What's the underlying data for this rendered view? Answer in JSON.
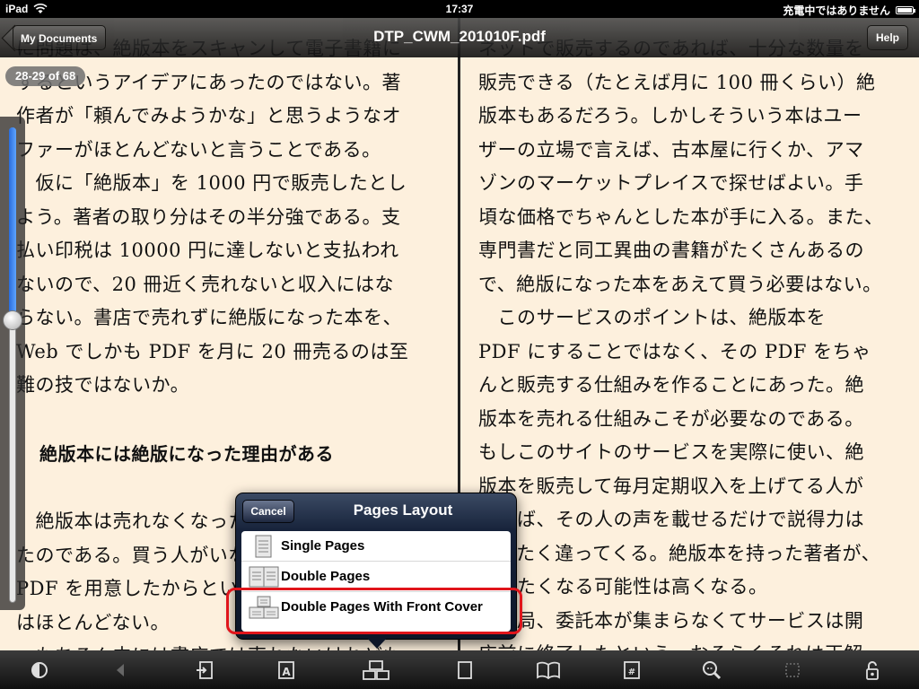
{
  "status_bar": {
    "device": "iPad",
    "time": "17:37",
    "charging": "充電中ではありません",
    "battery_level": 0.9
  },
  "nav": {
    "back_label": "My Documents",
    "title": "DTP_CWM_201010F.pdf",
    "help_label": "Help"
  },
  "page_indicator": "28-29 of 68",
  "slider": {
    "position": 0.41
  },
  "left_page": {
    "lines": [
      "に問題は、絶版本をスキャンして電子書籍に",
      "するというアイデアにあったのではない。著",
      "作者が「頼んでみようかな」と思うようなオ",
      "ファーがほとんどないと言うことである。",
      "　仮に「絶版本」を 1000 円で販売したとし",
      "よう。著者の取り分はその半分強である。支",
      "払い印税は 10000 円に達しないと支払われ",
      "ないので、20 冊近く売れないと収入にはな",
      "らない。書店で売れずに絶版になった本を、",
      "Web でしかも PDF を月に 20 冊売るのは至",
      "難の技ではないか。"
    ],
    "heading": "絶版本には絶版になった理由がある",
    "lines2": [
      "　絶版本は売れなくなったから絶版になっ",
      "たのである。買う人がいないのだから、",
      "PDF を用意したからといって売れる",
      "はほとんどない。",
      "　もちろん中には書店では売れないけれども、"
    ]
  },
  "right_page": {
    "lines": [
      "ネットで販売するのであれば、十分な数量を",
      "販売できる（たとえば月に 100 冊くらい）絶",
      "版本もあるだろう。しかしそういう本はユー",
      "ザーの立場で言えば、古本屋に行くか、アマ",
      "ゾンのマーケットプレイスで探せばよい。手",
      "頃な価格でちゃんとした本が手に入る。また、",
      "専門書だと同工異曲の書籍がたくさんあるの",
      "で、絶版になった本をあえて買う必要はない。",
      "　このサービスのポイントは、絶版本を",
      "PDF にすることではなく、その PDF をちゃ",
      "んと販売する仕組みを作ることにあった。絶",
      "版本を売れる仕組みこそが必要なのである。",
      "もしこのサイトのサービスを実際に使い、絶",
      "版本を販売して毎月定期収入を上げてる人が",
      "いれば、その人の声を載せるだけで説得力は",
      "まったく違ってくる。絶版本を持った著者が、",
      "出したくなる可能性は高くなる。",
      "　結局、委託本が集まらなくてサービスは開",
      "店前に終了したという。おそらくそれは正解"
    ]
  },
  "popover": {
    "cancel_label": "Cancel",
    "title": "Pages Layout",
    "options": [
      {
        "label": "Single Pages",
        "icon": "single-pages-icon"
      },
      {
        "label": "Double Pages",
        "icon": "double-pages-icon"
      },
      {
        "label": "Double Pages With Front Cover",
        "icon": "double-pages-cover-icon",
        "highlighted": true
      }
    ]
  },
  "toolbar": {
    "icons": [
      "brightness-icon",
      "back-arrow-icon",
      "export-icon",
      "font-icon",
      "page-layout-icon",
      "single-page-icon",
      "book-icon",
      "page-number-icon",
      "zoom-icon",
      "crop-icon",
      "lock-rotation-icon"
    ]
  },
  "colors": {
    "page_bg": "#fdf0dd",
    "highlight": "#e0151b",
    "slider_fill": "#2a6ddc"
  }
}
